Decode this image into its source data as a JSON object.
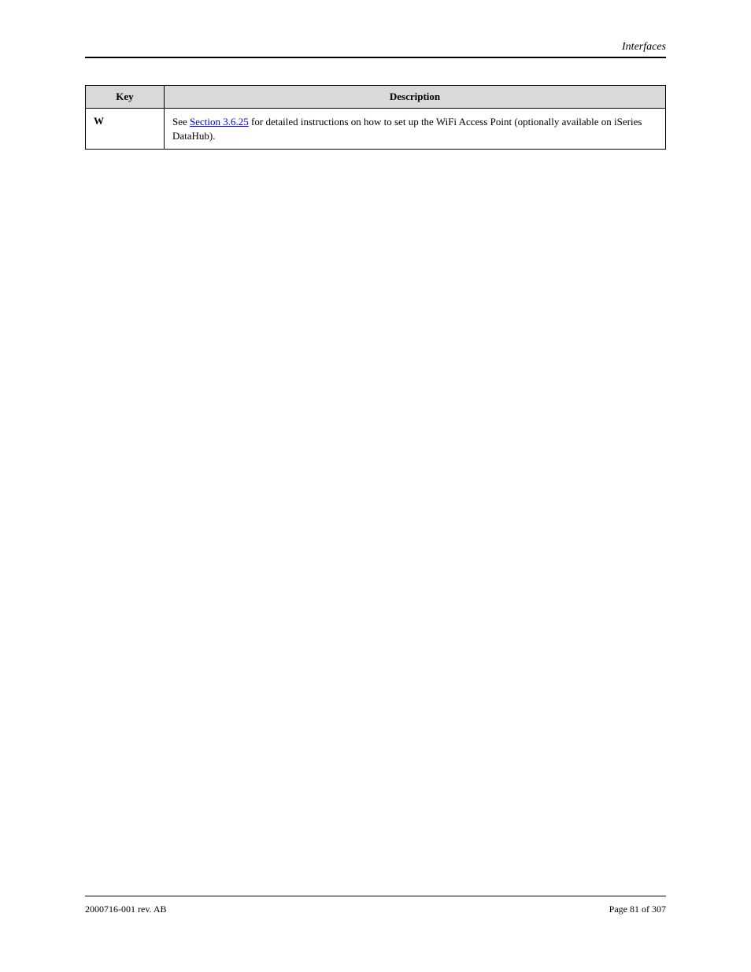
{
  "header": {
    "right": "Interfaces"
  },
  "table": {
    "headers": {
      "key": "Key",
      "description": "Description"
    },
    "row": {
      "key": "W",
      "link_text": "Section 3.6.25",
      "text_before": "See ",
      "text_after": " for detailed instructions on how to set up the WiFi Access Point (optionally available on iSeries DataHub)."
    }
  },
  "footer": {
    "left": "2000716-001 rev. AB",
    "right": "Page 81 of 307"
  }
}
